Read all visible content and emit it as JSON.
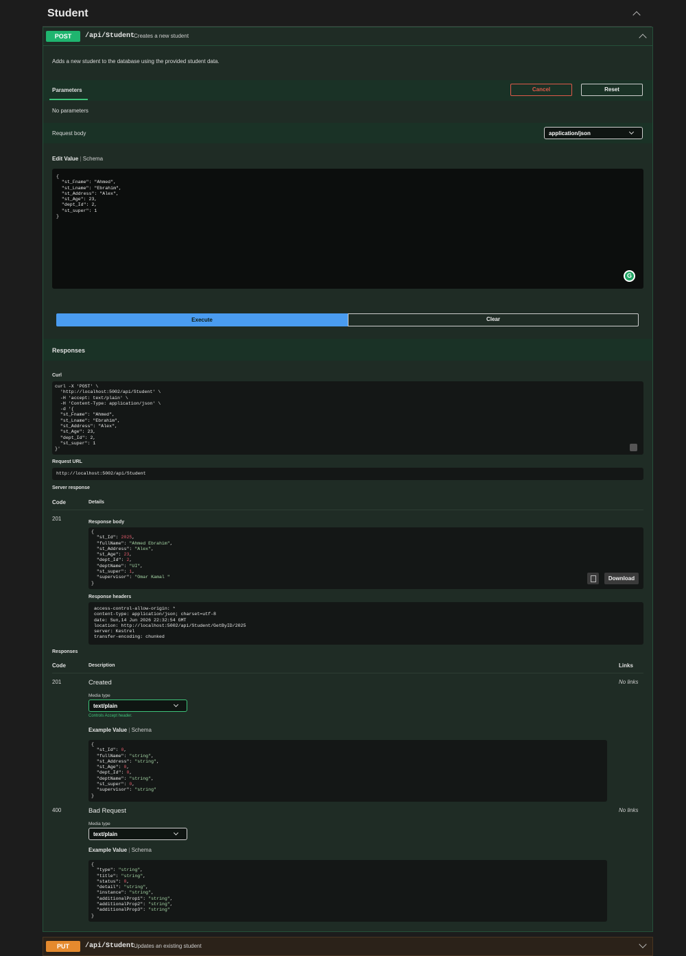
{
  "tag": {
    "title": "Student"
  },
  "post_op": {
    "method": "POST",
    "path": "/api/Student",
    "summary": "Creates a new student",
    "description": "Adds a new student to the database using the provided student data.",
    "parameters_tab": "Parameters",
    "cancel_label": "Cancel",
    "reset_label": "Reset",
    "no_parameters": "No parameters",
    "request_body_label": "Request body",
    "content_type": "application/json",
    "edit_value_label": "Edit Value",
    "schema_label": "Schema",
    "body_lines": [
      "{",
      "  \"st_Fname\": \"Ahmed\",",
      "  \"st_Lname\": \"Ebrahim\",",
      "  \"st_Address\": \"Alex\",",
      "  \"st_Age\": 23,",
      "  \"dept_Id\": 2,",
      "  \"st_super\": 1",
      "}"
    ],
    "execute_label": "Execute",
    "clear_label": "Clear"
  },
  "responses_header": "Responses",
  "live": {
    "curl_label": "Curl",
    "curl_lines": [
      "curl -X 'POST' \\",
      "  'http://localhost:5002/api/Student' \\",
      "  -H 'accept: text/plain' \\",
      "  -H 'Content-Type: application/json' \\",
      "  -d '{",
      "  \"st_Fname\": \"Ahmed\",",
      "  \"st_Lname\": \"Ebrahim\",",
      "  \"st_Address\": \"Alex\",",
      "  \"st_Age\": 23,",
      "  \"dept_Id\": 2,",
      "  \"st_super\": 1",
      "}'"
    ],
    "request_url_label": "Request URL",
    "request_url": "http://localhost:5002/api/Student",
    "server_response_label": "Server response",
    "code_header": "Code",
    "details_header": "Details",
    "code": "201",
    "response_body_label": "Response body",
    "response_body": {
      "st_Id": "2025",
      "fullName": "\"Ahmed Ebrahim\"",
      "st_Address": "\"Alex\"",
      "st_Age": "23",
      "dept_Id": "2",
      "deptName": "\"UI\"",
      "st_super": "1",
      "supervisor": "\"Omar Kamal \""
    },
    "download_label": "Download",
    "response_headers_label": "Response headers",
    "response_headers": [
      " access-control-allow-origin: * ",
      " content-type: application/json; charset=utf-8 ",
      " date: Sun,14 Jun 2026 22:32:54 GMT ",
      " location: http://localhost:5002/api/Student/GetByID/2025 ",
      " server: Kestrel ",
      " transfer-encoding: chunked "
    ]
  },
  "documented": {
    "label": "Responses",
    "code_header": "Code",
    "description_header": "Description",
    "links_header": "Links",
    "media_type_label": "Media type",
    "controls_accept": "Controls Accept header.",
    "example_value_label": "Example Value",
    "schema_label": "Schema",
    "r201": {
      "code": "201",
      "description": "Created",
      "links": "No links",
      "media_type": "text/plain",
      "example": {
        "st_Id": "0",
        "fullName": "\"string\"",
        "st_Address": "\"string\"",
        "st_Age": "0",
        "dept_Id": "0",
        "deptName": "\"string\"",
        "st_super": "0",
        "supervisor": "\"string\""
      }
    },
    "r400": {
      "code": "400",
      "description": "Bad Request",
      "links": "No links",
      "media_type": "text/plain",
      "example": {
        "type": "\"string\"",
        "title": "\"string\"",
        "status": "0",
        "detail": "\"string\"",
        "instance": "\"string\"",
        "additionalProp1": "\"string\"",
        "additionalProp2": "\"string\"",
        "additionalProp3": "\"string\""
      }
    }
  },
  "put_op": {
    "method": "PUT",
    "path": "/api/Student",
    "summary": "Updates an existing student"
  },
  "colors": {
    "post": "#1fb56f",
    "put": "#e58a2e",
    "execute": "#4a9cf0",
    "cancel": "#e05a4a",
    "accent_green": "#3ec47a"
  }
}
